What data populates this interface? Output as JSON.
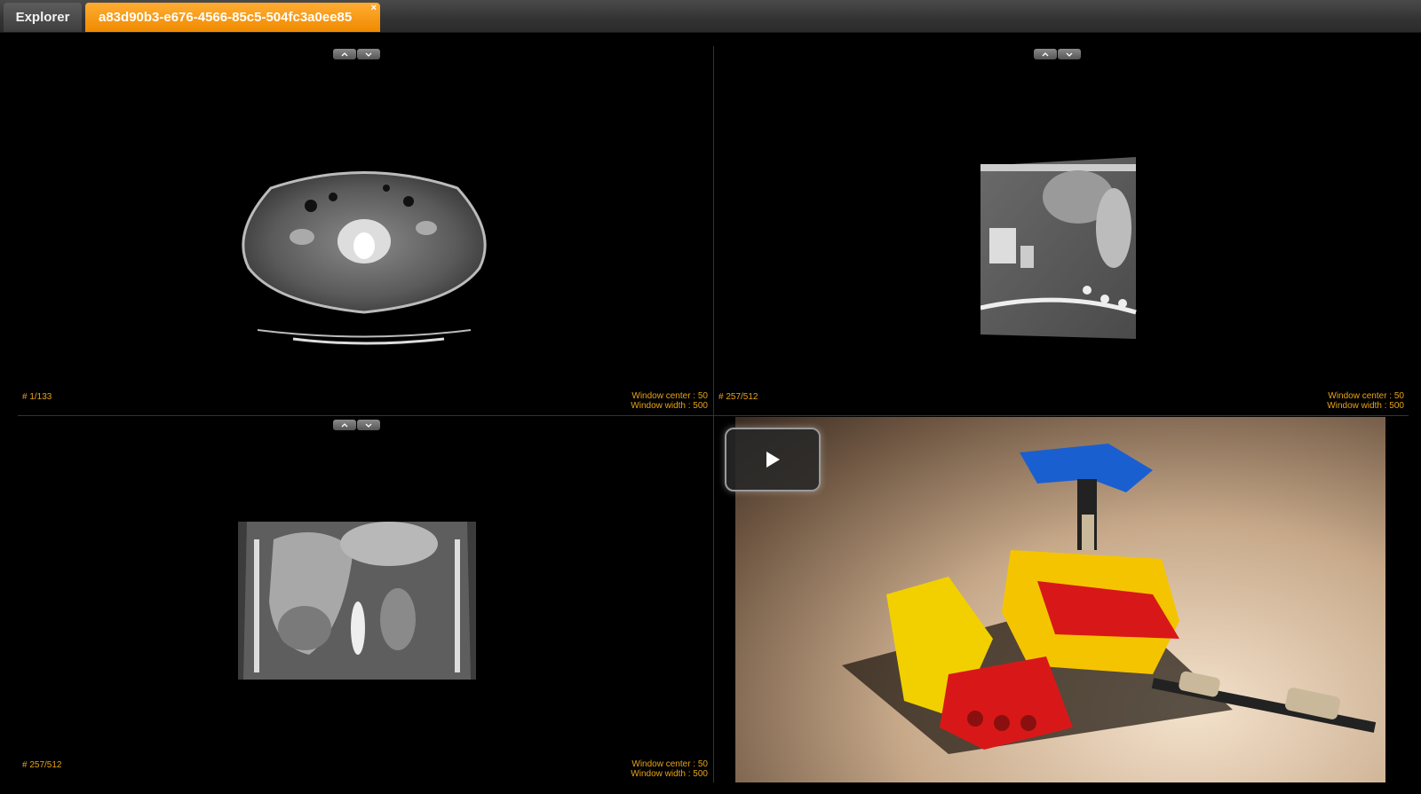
{
  "tabs": {
    "explorer_label": "Explorer",
    "study_label": "a83d90b3-e676-4566-85c5-504fc3a0ee85",
    "close_glyph": "×"
  },
  "viewports": {
    "axial": {
      "slice": "# 1/133",
      "window_center": "Window center : 50",
      "window_width": "Window width : 500"
    },
    "sagittal": {
      "slice": "# 257/512",
      "window_center": "Window center : 50",
      "window_width": "Window width : 500"
    },
    "coronal": {
      "slice": "# 257/512",
      "window_center": "Window center : 50",
      "window_width": "Window width : 500"
    },
    "video": {
      "play_icon": "play-icon"
    }
  },
  "colors": {
    "accent": "#f08a00",
    "overlay_text": "#e8a317"
  }
}
